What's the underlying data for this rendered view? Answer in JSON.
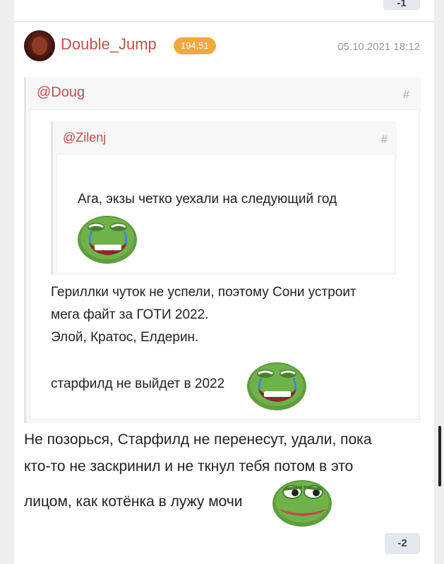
{
  "previous_comment": {
    "vote_label": "-1"
  },
  "comment": {
    "author": "Double_Jump",
    "karma": "194.51",
    "timestamp": "05.10.2021 18:12",
    "outer_quote": {
      "mention": "@Doug",
      "anchor": "#",
      "nested_quote": {
        "mention": "@Zilenj",
        "anchor": "#",
        "text": "Ага, экзы четко уехали на следующий год",
        "emoji": "pepe-laugh-cry-icon"
      },
      "lines": [
        "Гериллки чуток не успели, поэтому Сони устроит",
        "мега файт за ГОТИ 2022.",
        "Элой, Кратос, Елдерин."
      ],
      "last_line": "старфилд не выйдет в 2022",
      "last_emoji": "pepe-laugh-cry-icon"
    },
    "body_lines": [
      "Не позорься, Старфилд не перенесут, удали, пока",
      "кто-то не заскринил и не ткнул тебя потом в это"
    ],
    "body_last_line": "лицом, как котёнка в лужу мочи",
    "body_emoji": "pepe-smug-icon",
    "vote_label": "-2"
  },
  "colors": {
    "username": "#c0504d",
    "karma_badge": "#f2a93b",
    "vote_bg": "#e3e8ee"
  }
}
